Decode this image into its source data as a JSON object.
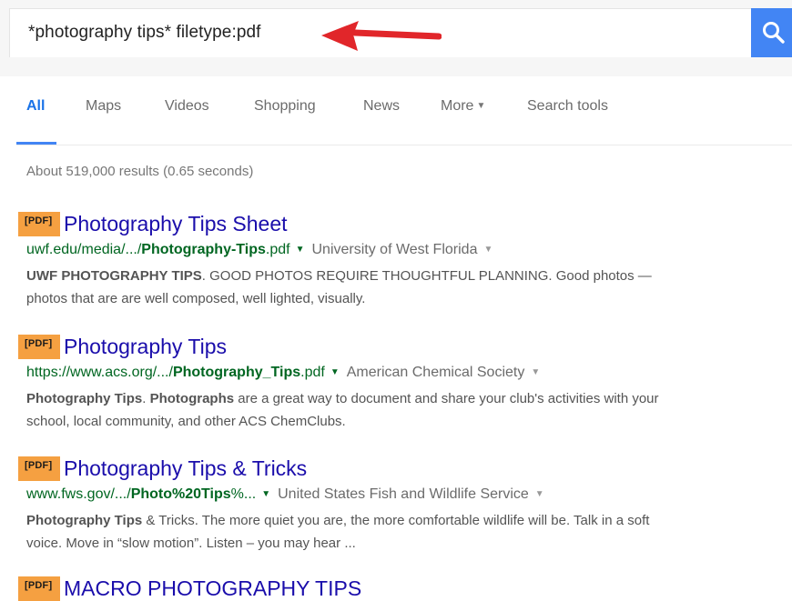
{
  "search": {
    "query": "*photography tips* filetype:pdf",
    "button_icon": "search-icon",
    "accent_color": "#4285f4",
    "annotation_arrow_color": "#e1262a"
  },
  "tabs": {
    "all": "All",
    "maps": "Maps",
    "videos": "Videos",
    "shopping": "Shopping",
    "news": "News",
    "more": "More",
    "search_tools": "Search tools"
  },
  "stats": "About 519,000 results (0.65 seconds)",
  "results": [
    {
      "badge": "[PDF]",
      "title": "Photography Tips Sheet",
      "url_prefix": "uwf.edu/media/.../",
      "url_bold": "Photography-Tips",
      "url_suffix": ".pdf",
      "source": "University of West Florida",
      "snippet_bold": "UWF PHOTOGRAPHY TIPS",
      "snippet_text": ". GOOD PHOTOS REQUIRE THOUGHTFUL PLANNING. Good photos — photos that are are well composed, well lighted, visually."
    },
    {
      "badge": "[PDF]",
      "title": "Photography Tips",
      "url_prefix": "https://www.acs.org/.../",
      "url_bold": "Photography_Tips",
      "url_suffix": ".pdf",
      "source": "American Chemical Society",
      "snippet_bold": "Photography Tips",
      "snippet_mid": ". ",
      "snippet_bold2": "Photographs",
      "snippet_text": " are a great way to document and share your club's activities with your school, local community, and other ACS ChemClubs."
    },
    {
      "badge": "[PDF]",
      "title": "Photography Tips & Tricks",
      "url_prefix": "www.fws.gov/.../",
      "url_bold": "Photo%20Tips",
      "url_suffix": "%...",
      "source": "United States Fish and Wildlife Service",
      "snippet_bold": "Photography Tips",
      "snippet_text": " & Tricks. The more quiet you are, the more comfortable wildlife will be. Talk in a soft voice. Move in “slow motion”. Listen – you may hear ..."
    },
    {
      "badge": "[PDF]",
      "title": "MACRO PHOTOGRAPHY TIPS"
    }
  ]
}
